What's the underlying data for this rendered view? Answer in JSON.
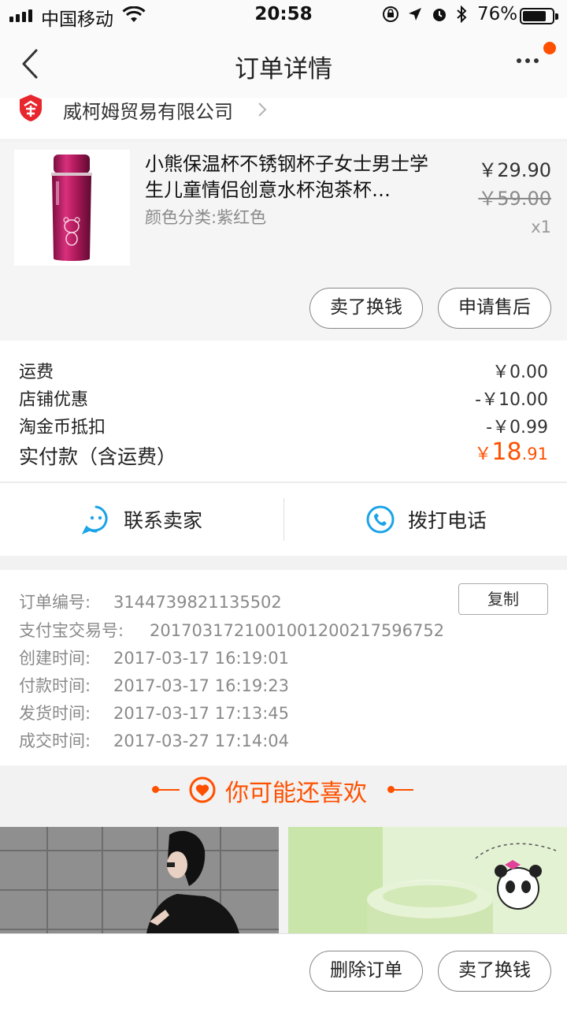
{
  "status_bar": {
    "carrier": "中国移动",
    "time": "20:58",
    "battery": "76%"
  },
  "nav": {
    "title": "订单详情"
  },
  "shop": {
    "name": "威柯姆贸易有限公司"
  },
  "product": {
    "title": "小熊保温杯不锈钢杯子女士男士学生儿童情侣创意水杯泡茶杯…",
    "sku": "颜色分类:紫红色",
    "price": "￥29.90",
    "original_price": "￥59.00",
    "quantity": "x1",
    "actions": [
      "卖了换钱",
      "申请售后"
    ]
  },
  "fees": [
    {
      "label": "运费",
      "value": "￥0.00"
    },
    {
      "label": "店铺优惠",
      "value": "-￥10.00"
    },
    {
      "label": "淘金币抵扣",
      "value": "-￥0.99"
    }
  ],
  "paid": {
    "label": "实付款（含运费）",
    "currency": "￥",
    "integer": "18",
    "decimal": ".91"
  },
  "contact": {
    "seller": "联系卖家",
    "phone": "拨打电话"
  },
  "order_info": {
    "copy_label": "复制",
    "rows": [
      {
        "label": "订单编号:",
        "value": "3144739821135502"
      },
      {
        "label": "支付宝交易号:",
        "value": "2017031721001001200217596752"
      },
      {
        "label": "创建时间:",
        "value": "2017-03-17 16:19:01"
      },
      {
        "label": "付款时间:",
        "value": "2017-03-17 16:19:23"
      },
      {
        "label": "发货时间:",
        "value": "2017-03-17 17:13:45"
      },
      {
        "label": "成交时间:",
        "value": "2017-03-27 17:14:04"
      }
    ]
  },
  "recommend": {
    "title": "你可能还喜欢"
  },
  "bottom_bar": {
    "buttons": [
      "删除订单",
      "卖了换钱"
    ]
  },
  "colors": {
    "accent": "#ff5000",
    "contact_icon": "#1aa3e8"
  }
}
